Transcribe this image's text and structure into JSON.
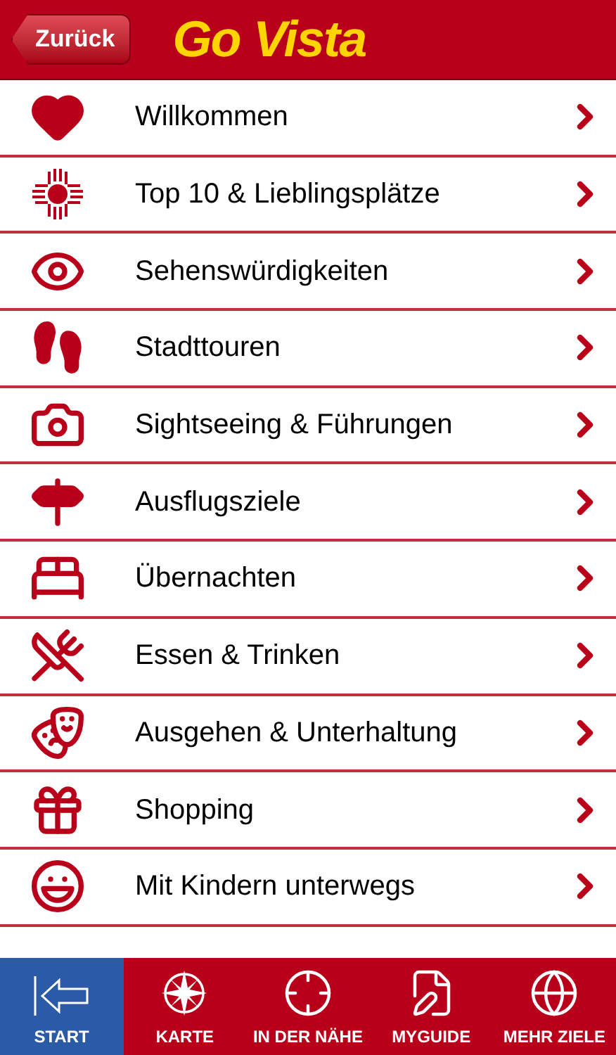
{
  "header": {
    "back_button": "Zurück",
    "title": "Go Vista"
  },
  "menu": [
    {
      "label": "Willkommen"
    },
    {
      "label": "Top 10 & Lieblingsplätze"
    },
    {
      "label": "Sehenswürdigkeiten"
    },
    {
      "label": "Stadttouren"
    },
    {
      "label": "Sightseeing & Führungen"
    },
    {
      "label": "Ausflugsziele"
    },
    {
      "label": "Übernachten"
    },
    {
      "label": "Essen & Trinken"
    },
    {
      "label": "Ausgehen & Unterhaltung"
    },
    {
      "label": "Shopping"
    },
    {
      "label": "Mit Kindern unterwegs"
    }
  ],
  "tab_bar": [
    {
      "label": "START",
      "selected": true
    },
    {
      "label": "KARTE",
      "selected": false
    },
    {
      "label": "IN DER NÄHE",
      "selected": false
    },
    {
      "label": "MYGUIDE",
      "selected": false
    },
    {
      "label": "MEHR ZIELE",
      "selected": false
    }
  ]
}
